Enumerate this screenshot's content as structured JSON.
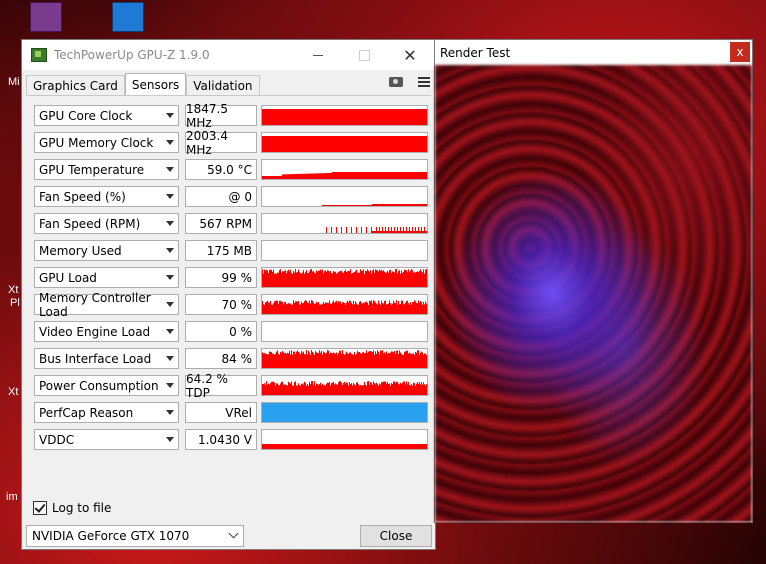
{
  "desktop": {
    "labels": [
      "Mi",
      "Xt",
      "Pl",
      "Xt",
      "im"
    ],
    "accent": "#b0101a"
  },
  "gpuz": {
    "title": "TechPowerUp GPU-Z 1.9.0",
    "close_glyph": "✕",
    "tabs": [
      {
        "label": "Graphics Card",
        "active": false
      },
      {
        "label": "Sensors",
        "active": true
      },
      {
        "label": "Validation",
        "active": false
      }
    ],
    "icons": [
      "camera-icon",
      "menu-icon"
    ],
    "sensors": [
      {
        "label": "GPU Core Clock",
        "value": "1847.5 MHz",
        "graph": "full"
      },
      {
        "label": "GPU Memory Clock",
        "value": "2003.4 MHz",
        "graph": "full"
      },
      {
        "label": "GPU Temperature",
        "value": "59.0 °C",
        "graph": "temp"
      },
      {
        "label": "Fan Speed (%)",
        "value": "@ 0",
        "graph": "fanpct"
      },
      {
        "label": "Fan Speed (RPM)",
        "value": "567 RPM",
        "graph": "fanrpm"
      },
      {
        "label": "Memory Used",
        "value": "175 MB",
        "graph": "none"
      },
      {
        "label": "GPU Load",
        "value": "99 %",
        "graph": "noisy-high"
      },
      {
        "label": "Memory Controller Load",
        "value": "70 %",
        "graph": "noisy-mid"
      },
      {
        "label": "Video Engine Load",
        "value": "0 %",
        "graph": "none"
      },
      {
        "label": "Bus Interface Load",
        "value": "84 %",
        "graph": "noisy-high"
      },
      {
        "label": "Power Consumption",
        "value": "64.2 % TDP",
        "graph": "noisy-mid"
      },
      {
        "label": "PerfCap Reason",
        "value": "VRel",
        "graph": "blue"
      },
      {
        "label": "VDDC",
        "value": "1.0430 V",
        "graph": "vddc"
      }
    ],
    "log_label": "Log to file",
    "log_checked": true,
    "gpu_name": "NVIDIA GeForce GTX 1070",
    "close_label": "Close",
    "graph_color": "#ff0000",
    "perfcap_color": "#2aa1ee"
  },
  "render": {
    "title": "Render Test",
    "close_glyph": "x"
  }
}
